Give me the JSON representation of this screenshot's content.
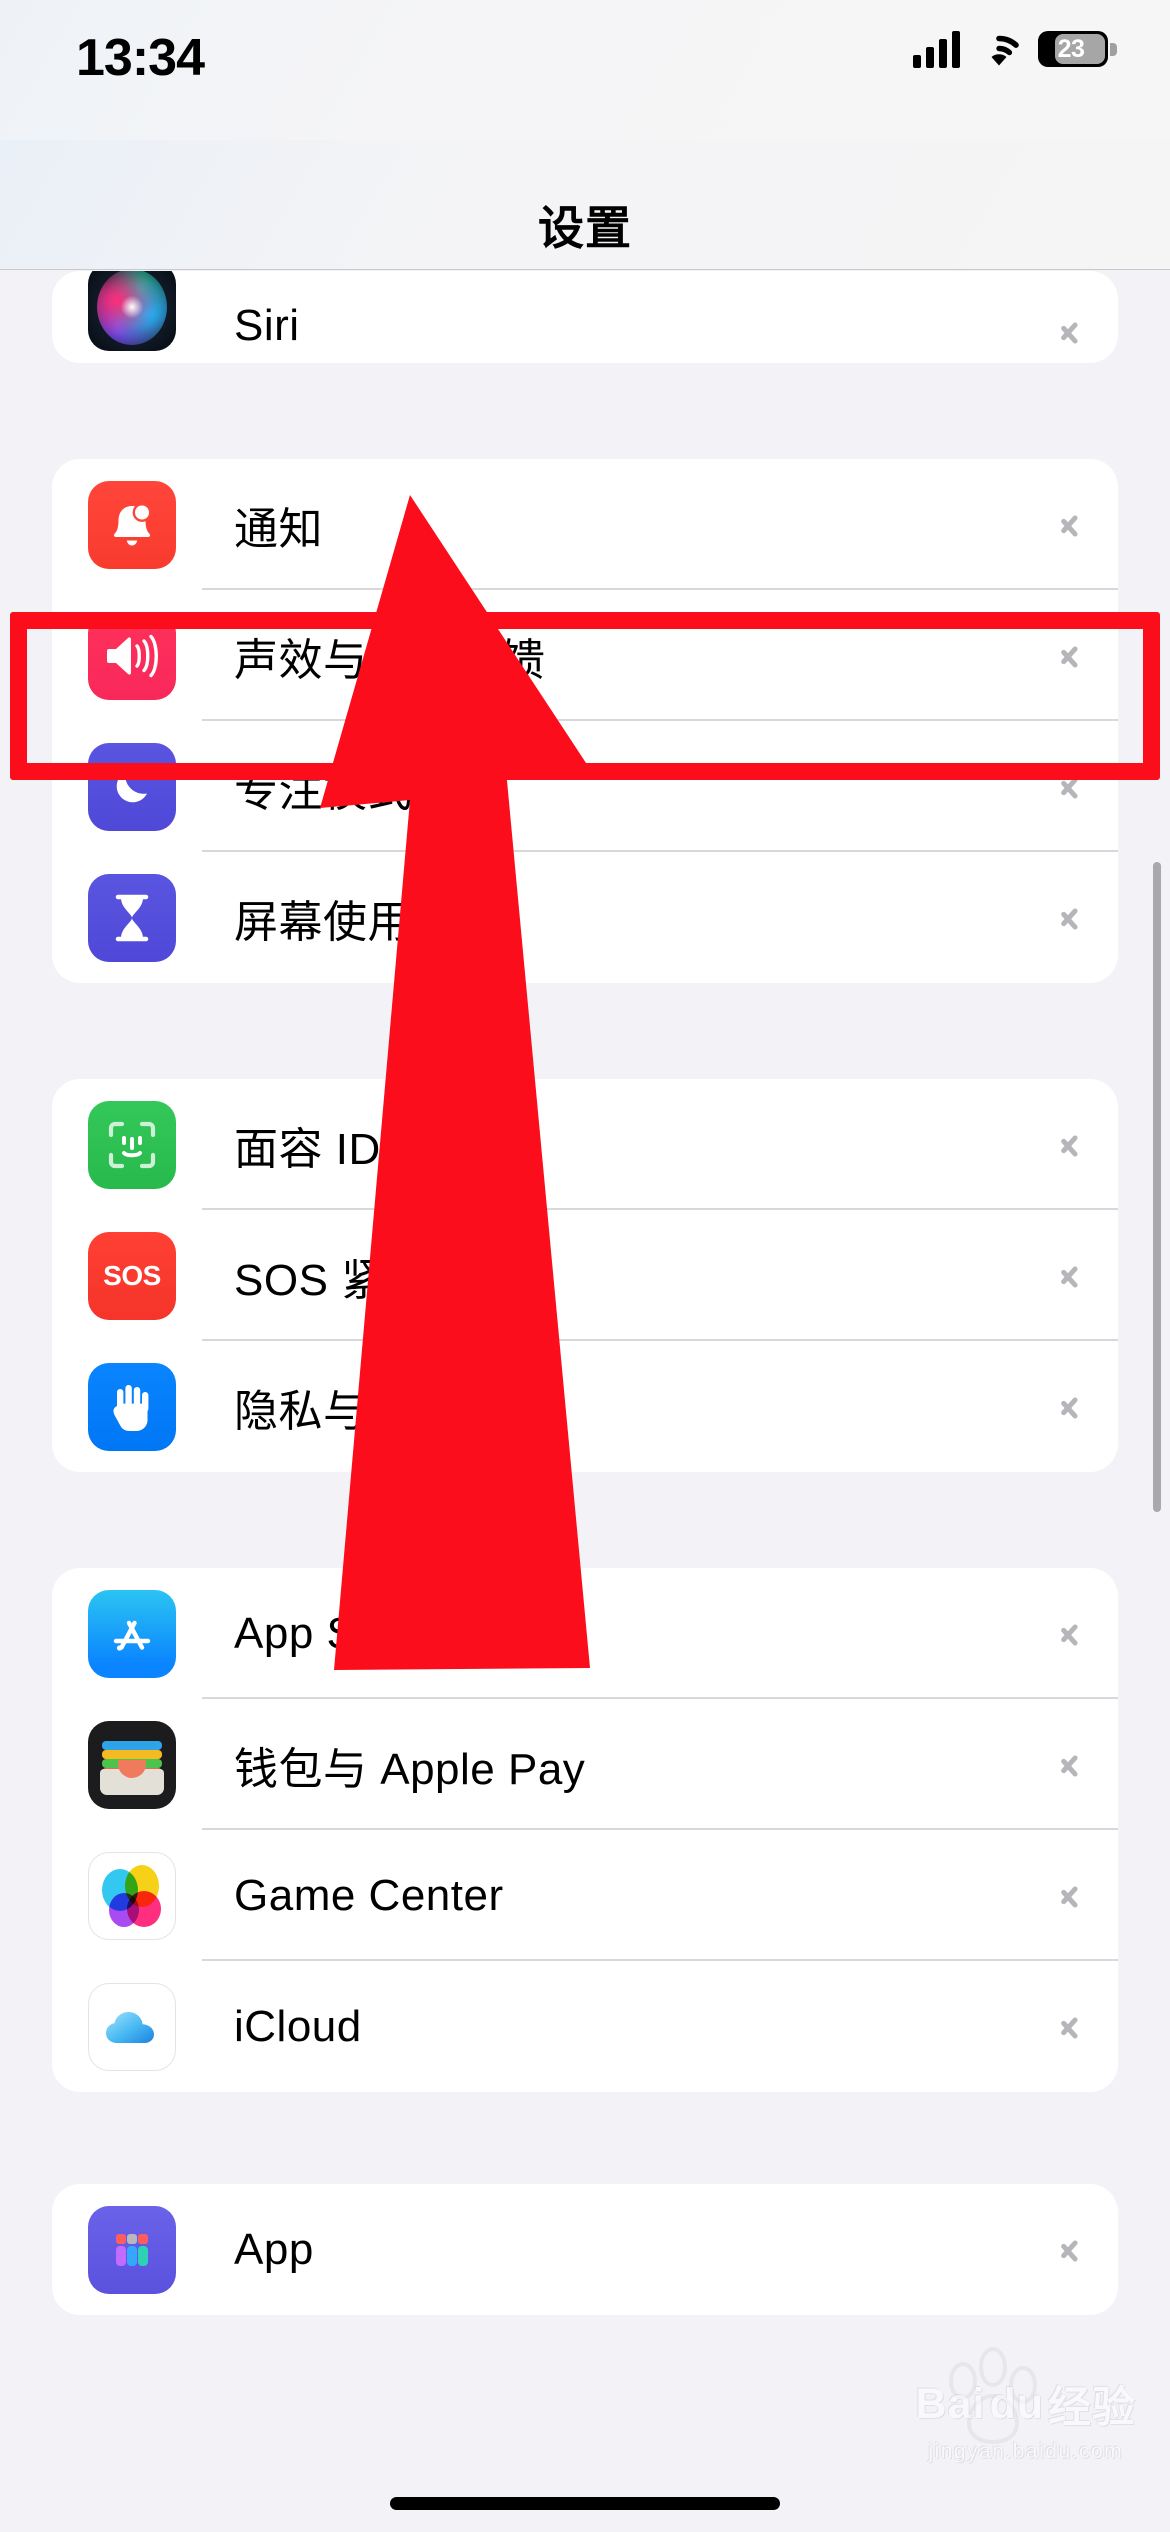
{
  "status_bar": {
    "time": "13:34",
    "battery_percent": "23",
    "signal_icon": "cellular-signal-icon",
    "wifi_icon": "wifi-icon",
    "battery_icon": "battery-icon"
  },
  "nav_bar": {
    "title": "设置"
  },
  "groups": [
    {
      "id": "group-siri",
      "rows": [
        {
          "label": "Siri",
          "icon": "siri-icon",
          "icon_class": "ic-siri",
          "clipped": true
        }
      ]
    },
    {
      "id": "group-notifications",
      "rows": [
        {
          "label": "通知",
          "icon": "bell-icon",
          "icon_class": "ic-bell"
        },
        {
          "label": "声效与触感反馈",
          "icon": "speaker-waves-icon",
          "icon_class": "ic-sound",
          "highlighted": true
        },
        {
          "label": "专注模式",
          "icon": "crescent-moon-icon",
          "icon_class": "ic-focus"
        },
        {
          "label": "屏幕使用时间",
          "icon": "hourglass-icon",
          "icon_class": "ic-screen"
        }
      ]
    },
    {
      "id": "group-security",
      "rows": [
        {
          "label": "面容 ID 与密码",
          "icon": "face-id-icon",
          "icon_class": "ic-faceid"
        },
        {
          "label": "SOS 紧急联络",
          "icon": "sos-icon",
          "icon_class": "ic-sos"
        },
        {
          "label": "隐私与安全性",
          "icon": "hand-raised-icon",
          "icon_class": "ic-privacy"
        }
      ]
    },
    {
      "id": "group-services",
      "rows": [
        {
          "label": "App Store",
          "icon": "app-store-icon",
          "icon_class": "ic-appstore"
        },
        {
          "label": "钱包与 Apple Pay",
          "icon": "wallet-icon",
          "icon_class": "ic-wallet"
        },
        {
          "label": "Game Center",
          "icon": "game-center-icon",
          "icon_class": "ic-gc"
        },
        {
          "label": "iCloud",
          "icon": "icloud-icon",
          "icon_class": "ic-icloud"
        }
      ]
    },
    {
      "id": "group-apps",
      "rows": [
        {
          "label": "App",
          "icon": "app-grid-icon",
          "icon_class": "ic-app"
        }
      ]
    }
  ],
  "annotation": {
    "highlight_color": "#fb0d1b",
    "arrow_color": "#fb0d1b",
    "target_row_label": "声效与触感反馈"
  },
  "watermark": {
    "brand": "Bai",
    "brand_tail": "du",
    "suffix": "经验",
    "url": "jingyan.baidu.com"
  },
  "chevron_icon": "chevron-right-icon",
  "home_indicator": "home-indicator"
}
